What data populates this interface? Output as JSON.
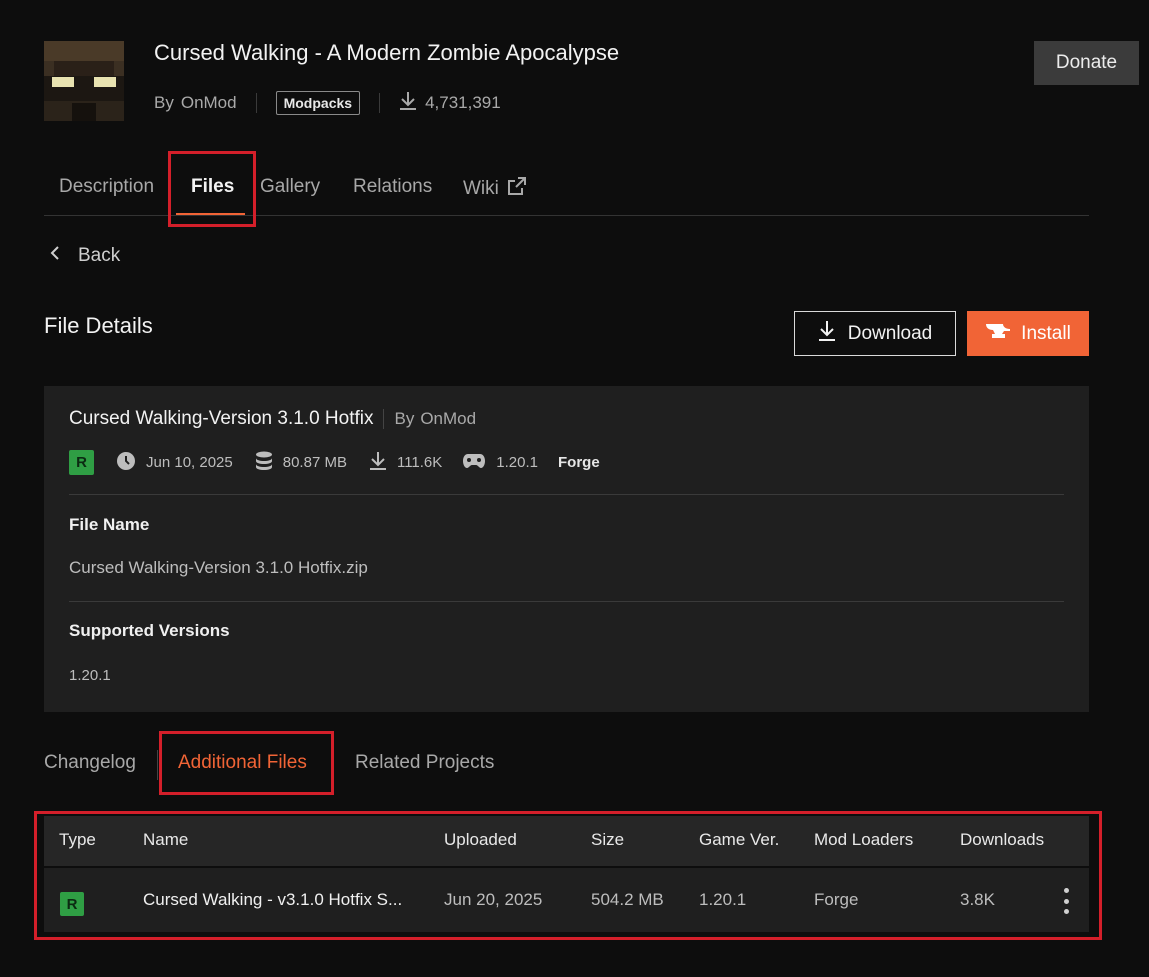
{
  "project": {
    "title": "Cursed Walking - A Modern Zombie Apocalypse",
    "by_label": "By",
    "author": "OnMod",
    "category_tag": "Modpacks",
    "downloads": "4,731,391",
    "donate_label": "Donate"
  },
  "tabs": [
    {
      "label": "Description"
    },
    {
      "label": "Files"
    },
    {
      "label": "Gallery"
    },
    {
      "label": "Relations"
    },
    {
      "label": "Wiki"
    }
  ],
  "back_label": "Back",
  "file_details": {
    "section_title": "File Details",
    "download_label": "Download",
    "install_label": "Install",
    "file_display_name": "Cursed Walking-Version 3.1.0 Hotfix",
    "by_label": "By",
    "author": "OnMod",
    "release_badge": "R",
    "date": "Jun 10, 2025",
    "size": "80.87 MB",
    "downloads": "111.6K",
    "game_version": "1.20.1",
    "loader": "Forge",
    "file_name_label": "File Name",
    "file_name": "Cursed Walking-Version 3.1.0 Hotfix.zip",
    "supported_versions_label": "Supported Versions",
    "supported_versions": "1.20.1"
  },
  "sub_tabs": [
    {
      "label": "Changelog"
    },
    {
      "label": "Additional Files"
    },
    {
      "label": "Related Projects"
    }
  ],
  "additional_files": {
    "columns": [
      "Type",
      "Name",
      "Uploaded",
      "Size",
      "Game Ver.",
      "Mod Loaders",
      "Downloads"
    ],
    "rows": [
      {
        "type": "R",
        "name": "Cursed Walking - v3.1.0 Hotfix S...",
        "uploaded": "Jun 20, 2025",
        "size": "504.2 MB",
        "game_version": "1.20.1",
        "mod_loader": "Forge",
        "downloads": "3.8K"
      }
    ]
  },
  "colors": {
    "accent": "#f16436",
    "release_green": "#2f9e44",
    "highlight_box": "#d41f2a",
    "background": "#0d0d0d",
    "card": "#1f1f1f"
  },
  "icons": [
    "download-icon",
    "external-link-icon",
    "chevron-left-icon",
    "anvil-icon",
    "clock-icon",
    "database-icon",
    "gamepad-icon",
    "kebab-menu-icon"
  ]
}
